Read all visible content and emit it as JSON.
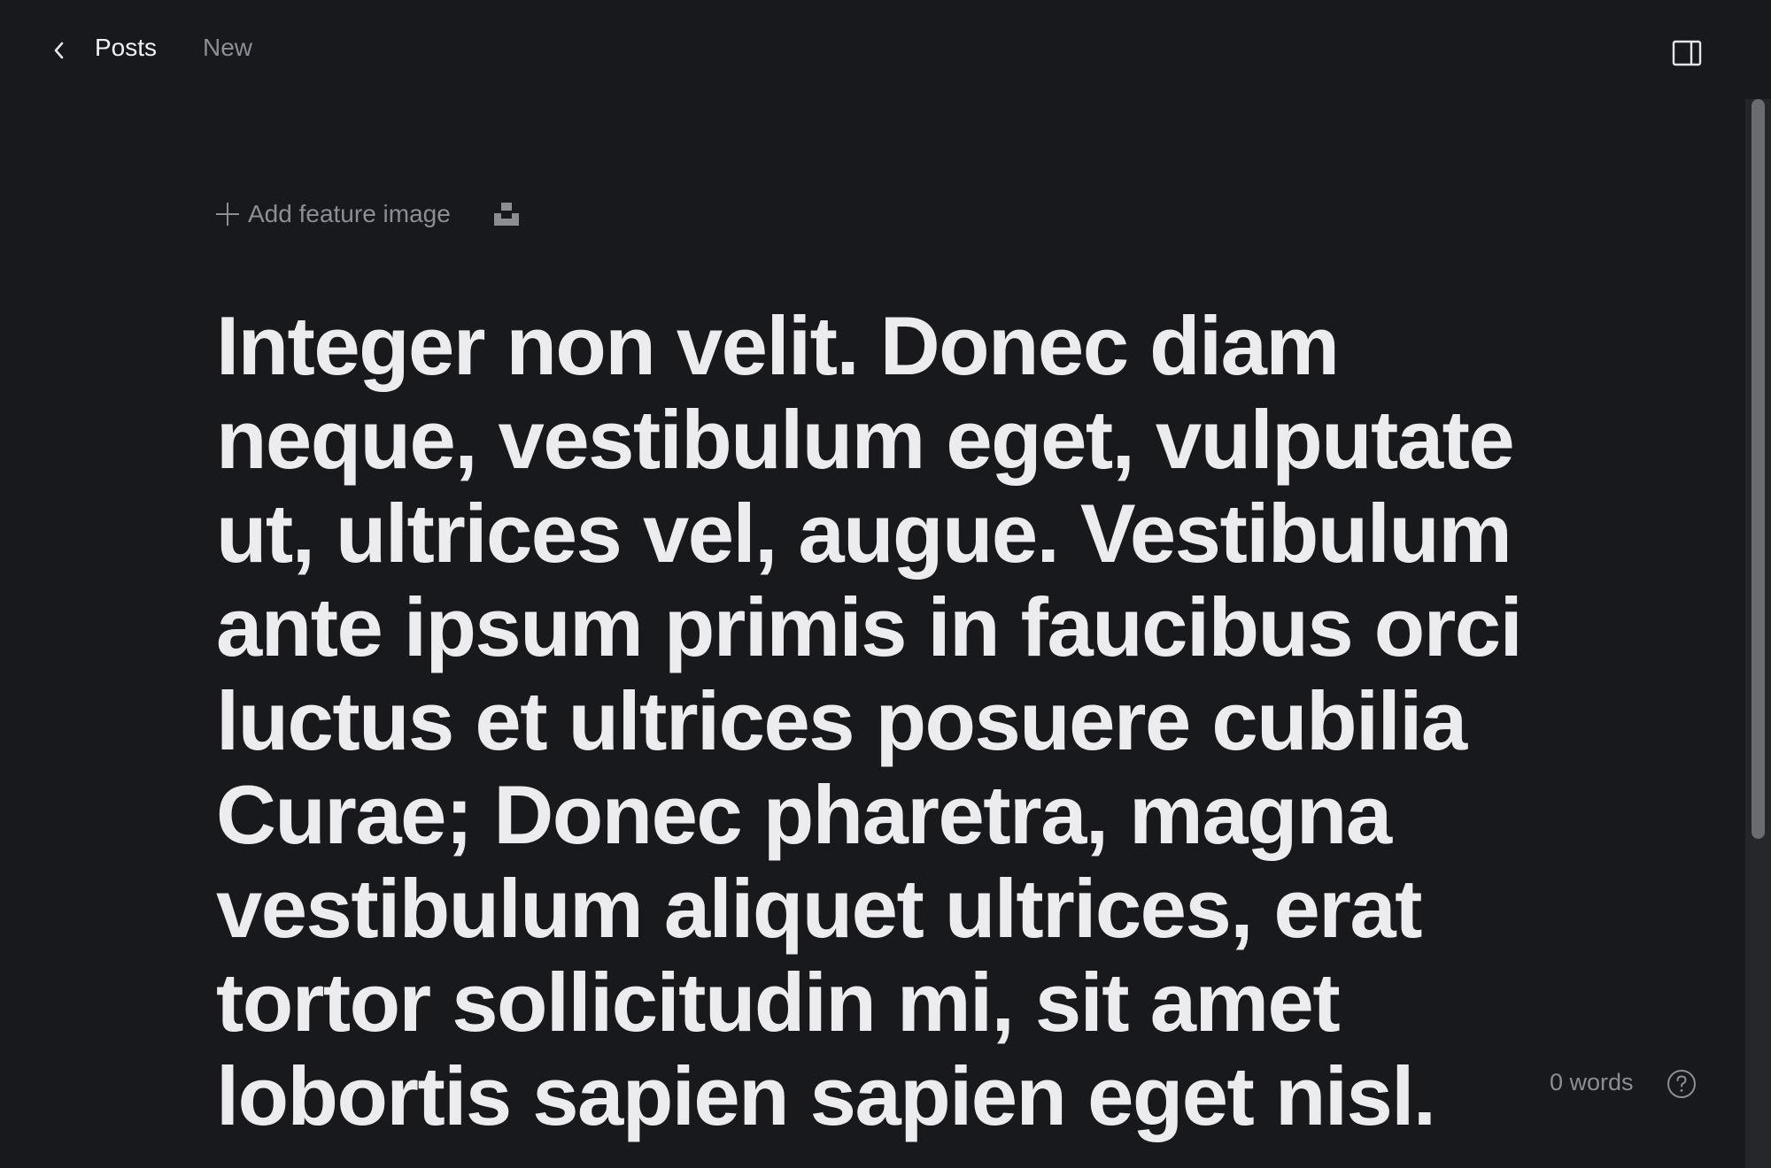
{
  "header": {
    "breadcrumb_parent": "Posts",
    "breadcrumb_status": "New"
  },
  "editor": {
    "add_feature_image_label": "Add feature image",
    "title": "Integer non velit. Donec diam neque, vestibulum eget, vulputate ut, ultrices vel, augue. Vestibulum ante ipsum primis in faucibus orci luctus et ultrices posuere cubilia Curae; Donec pharetra, magna vestibulum aliquet ultrices, erat tortor sollicitudin mi, sit amet lobortis sapien sapien eget nisl."
  },
  "footer": {
    "word_count": "0 words"
  },
  "icons": {
    "back": "chevron-left-icon",
    "sidebar": "sidebar-toggle-icon",
    "add": "plus-icon",
    "unsplash": "unsplash-icon",
    "help": "help-circle-icon"
  },
  "colors": {
    "background": "#18191d",
    "text": "#ececee",
    "muted": "#8d8e94"
  }
}
